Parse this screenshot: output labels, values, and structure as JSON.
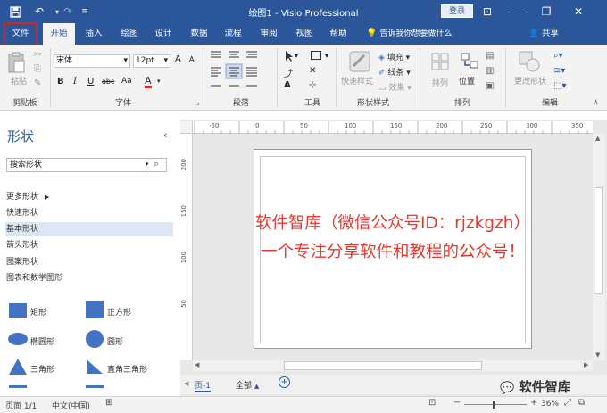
{
  "app": {
    "title": "绘图1 - Visio Professional",
    "login_label": "登录",
    "window_controls": {
      "ribbon_options": "⊡",
      "minimize": "—",
      "restore": "❐",
      "close": "✕"
    }
  },
  "quick_access": {
    "save_icon": "save-icon",
    "undo_icon": "undo-icon",
    "redo_icon": "redo-icon",
    "customize_icon": "customize-icon"
  },
  "tabs": [
    "文件",
    "开始",
    "插入",
    "绘图",
    "设计",
    "数据",
    "流程",
    "审阅",
    "视图",
    "帮助"
  ],
  "tell_me": "告诉我你想要做什么",
  "share": "共享",
  "ribbon": {
    "clipboard": {
      "paste": "粘贴",
      "group": "剪贴板"
    },
    "font": {
      "font_name": "宋体",
      "font_size": "12pt",
      "grow": "A",
      "shrink": "A",
      "bold": "B",
      "italic": "I",
      "underline": "U",
      "strike": "abc",
      "case": "Aa",
      "color": "A",
      "group": "字体"
    },
    "paragraph": {
      "group": "段落"
    },
    "tools": {
      "text": "A",
      "group": "工具"
    },
    "shape_styles": {
      "quick_styles": "快速样式",
      "fill": "填充",
      "line": "线条",
      "effects": "效果",
      "group": "形状样式"
    },
    "arrange": {
      "align": "排列",
      "position": "位置",
      "group": "排列"
    },
    "editing": {
      "change_shape": "更改形状",
      "group": "编辑"
    }
  },
  "shapes_pane": {
    "title": "形状",
    "search_placeholder": "搜索形状",
    "more_shapes": "更多形状",
    "stencils": [
      "快速形状",
      "基本形状",
      "箭头形状",
      "图案形状",
      "图表和数学图形"
    ],
    "shapes": [
      {
        "label": "矩形",
        "icon": "rectangle-icon"
      },
      {
        "label": "正方形",
        "icon": "square-icon"
      },
      {
        "label": "椭圆形",
        "icon": "ellipse-icon"
      },
      {
        "label": "圆形",
        "icon": "circle-icon"
      },
      {
        "label": "三角形",
        "icon": "triangle-icon"
      },
      {
        "label": "直角三角形",
        "icon": "right-triangle-icon"
      }
    ]
  },
  "ruler": {
    "horizontal": [
      "-50",
      "0",
      "50",
      "100",
      "150",
      "200",
      "250",
      "300",
      "350"
    ],
    "vertical": [
      "200",
      "150",
      "100",
      "50"
    ]
  },
  "canvas": {
    "watermark_line1": "软件智库（微信公众号ID：rjzkgzh）",
    "watermark_line2": "一个专注分享软件和教程的公众号！"
  },
  "page_tabs": {
    "page1": "页-1",
    "all": "全部"
  },
  "status": {
    "page": "页面 1/1",
    "language": "中文(中国)",
    "zoom": "36%"
  },
  "brand": {
    "wechat": "软件智库"
  },
  "colors": {
    "accent": "#2b579a",
    "highlight": "#e02020",
    "watermark": "#e5392f"
  }
}
